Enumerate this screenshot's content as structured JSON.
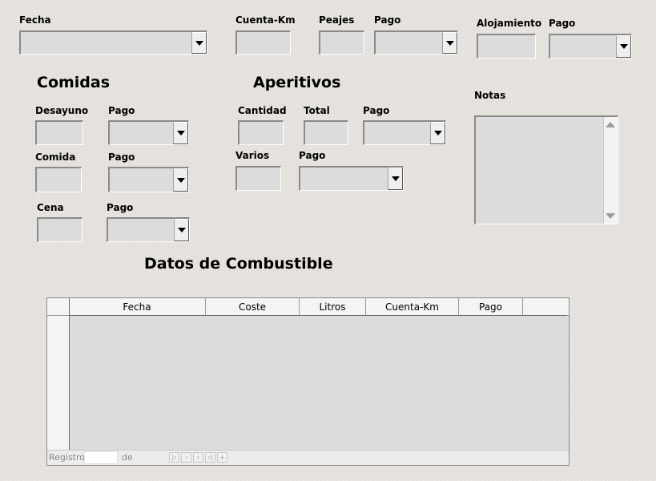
{
  "top": {
    "fecha_label": "Fecha",
    "cuenta_km_label": "Cuenta-Km",
    "peajes_label": "Peajes",
    "pago_label_1": "Pago",
    "alojamiento_label": "Alojamiento",
    "pago_label_2": "Pago"
  },
  "comidas": {
    "heading": "Comidas",
    "desayuno_label": "Desayuno",
    "desayuno_pago_label": "Pago",
    "comida_label": "Comida",
    "comida_pago_label": "Pago",
    "cena_label": "Cena",
    "cena_pago_label": "Pago"
  },
  "aperitivos": {
    "heading": "Aperitivos",
    "cantidad_label": "Cantidad",
    "total_label": "Total",
    "pago_label": "Pago",
    "varios_label": "Varios",
    "varios_pago_label": "Pago"
  },
  "notas": {
    "label": "Notas"
  },
  "combustible": {
    "heading": "Datos de Combustible",
    "columns": [
      "Fecha",
      "Coste",
      "Litros",
      "Cuenta-Km",
      "Pago"
    ]
  },
  "navigation": {
    "registro_label": "Registro",
    "de_label": "de"
  },
  "icons": {
    "dropdown": "chevron-down-icon",
    "scroll_up": "scroll-up-icon",
    "scroll_down": "scroll-down-icon",
    "nav_first": "first-record-icon",
    "nav_prev": "previous-record-icon",
    "nav_next": "next-record-icon",
    "nav_last": "last-record-icon",
    "nav_new": "new-record-icon"
  },
  "colors": {
    "background": "#e6e3de",
    "field": "#dcdcdc"
  }
}
